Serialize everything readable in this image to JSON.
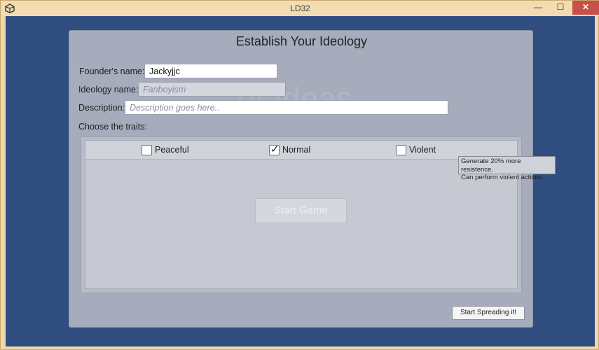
{
  "window": {
    "title": "LD32",
    "controls": {
      "minimize": "—",
      "maximize": "☐",
      "close": "✕"
    }
  },
  "dialog": {
    "title": "Establish Your Ideology",
    "watermark": "...of Ideas",
    "founder": {
      "label": "Founder's name:",
      "value": "Jackyjjc"
    },
    "ideology": {
      "label": "Ideology name:",
      "placeholder": "Fanboyism"
    },
    "description": {
      "label": "Description:",
      "placeholder": "Description goes here.."
    },
    "traits_label": "Choose the traits:",
    "traits": [
      {
        "label": "Peaceful",
        "checked": false
      },
      {
        "label": "Normal",
        "checked": true
      },
      {
        "label": "Violent",
        "checked": false
      }
    ],
    "start_game": "Start Game",
    "tooltip": {
      "line1": "Generate 20% more resistence.",
      "line2": "Can perform violent actions."
    },
    "spread_button": "Start Spreading it!"
  },
  "colors": {
    "background": "#2f4e7f",
    "panel": "#a6acbb",
    "titlebar": "#f3dbb2",
    "close": "#c7504a"
  }
}
